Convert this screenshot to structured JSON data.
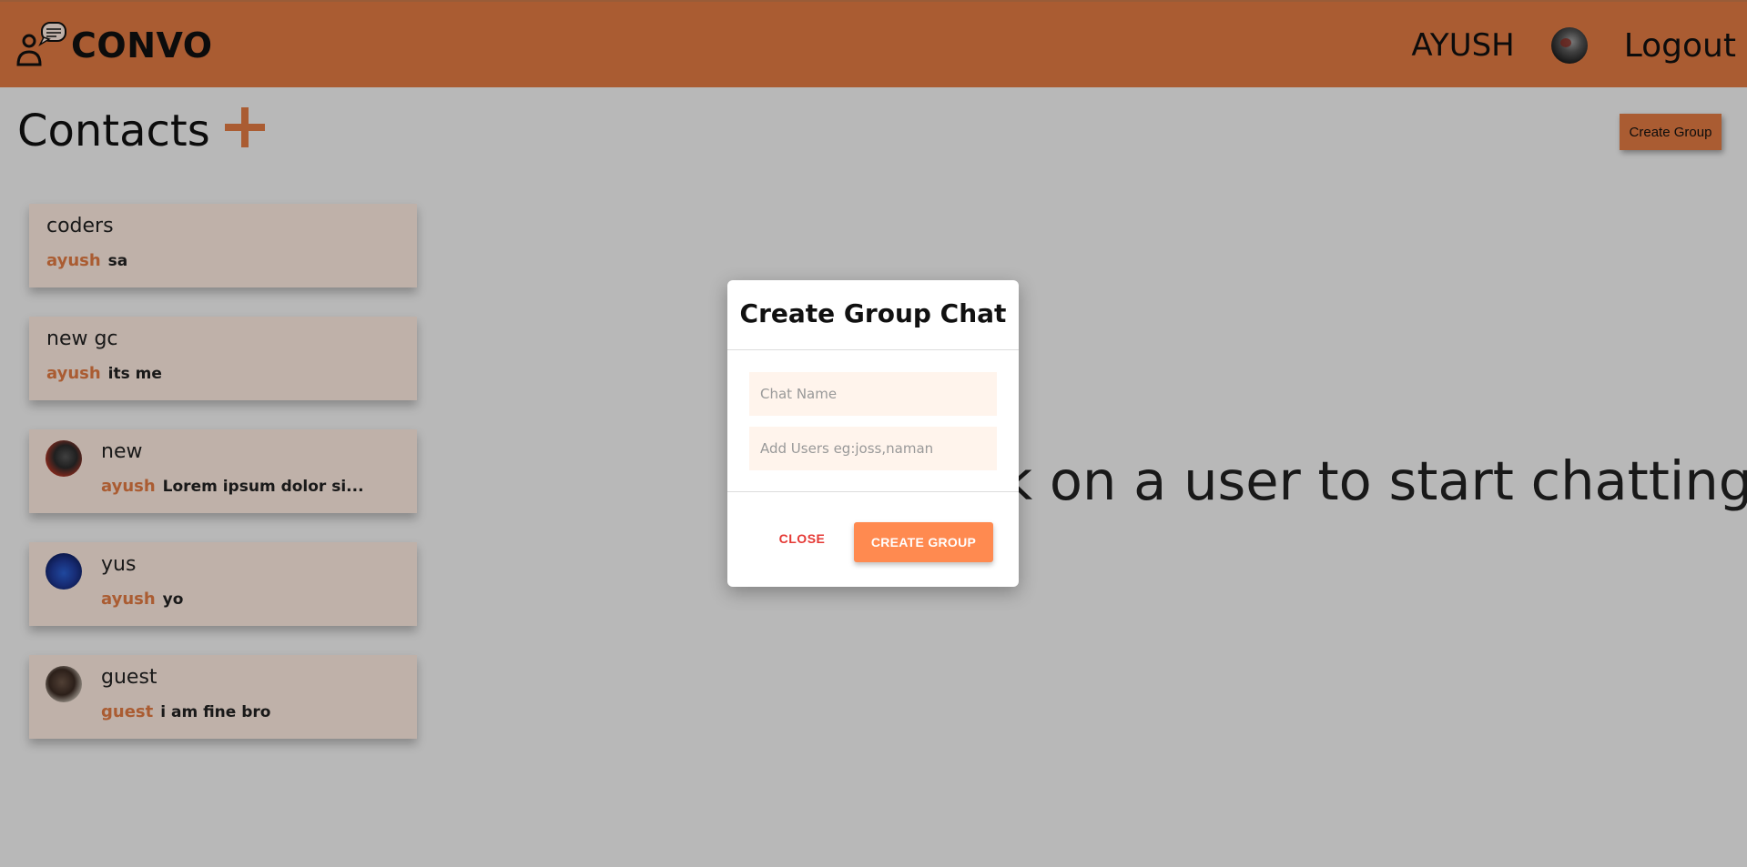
{
  "navbar": {
    "brand": "CONVO",
    "username": "AYUSH",
    "logout_label": "Logout",
    "color": "#e07a42"
  },
  "header": {
    "title": "Contacts",
    "create_group_label": "Create Group"
  },
  "contacts": [
    {
      "name": "coders",
      "sender": "ayush",
      "message": "sa",
      "avatar": null
    },
    {
      "name": "new gc",
      "sender": "ayush",
      "message": "its me",
      "avatar": null
    },
    {
      "name": "new",
      "sender": "ayush",
      "message": "Lorem ipsum dolor si...",
      "avatar": "red-mask-avatar"
    },
    {
      "name": "yus",
      "sender": "ayush",
      "message": "yo",
      "avatar": "blue-kit-avatar"
    },
    {
      "name": "guest",
      "sender": "guest",
      "message": "i am fine bro",
      "avatar": "portrait-avatar"
    }
  ],
  "main": {
    "empty_text": "k on a user to start chatting"
  },
  "modal": {
    "title": "Create Group Chat",
    "chat_name_placeholder": "Chat Name",
    "add_users_placeholder": "Add Users eg:joss,naman",
    "close_label": "CLOSE",
    "create_label": "CREATE GROUP"
  }
}
